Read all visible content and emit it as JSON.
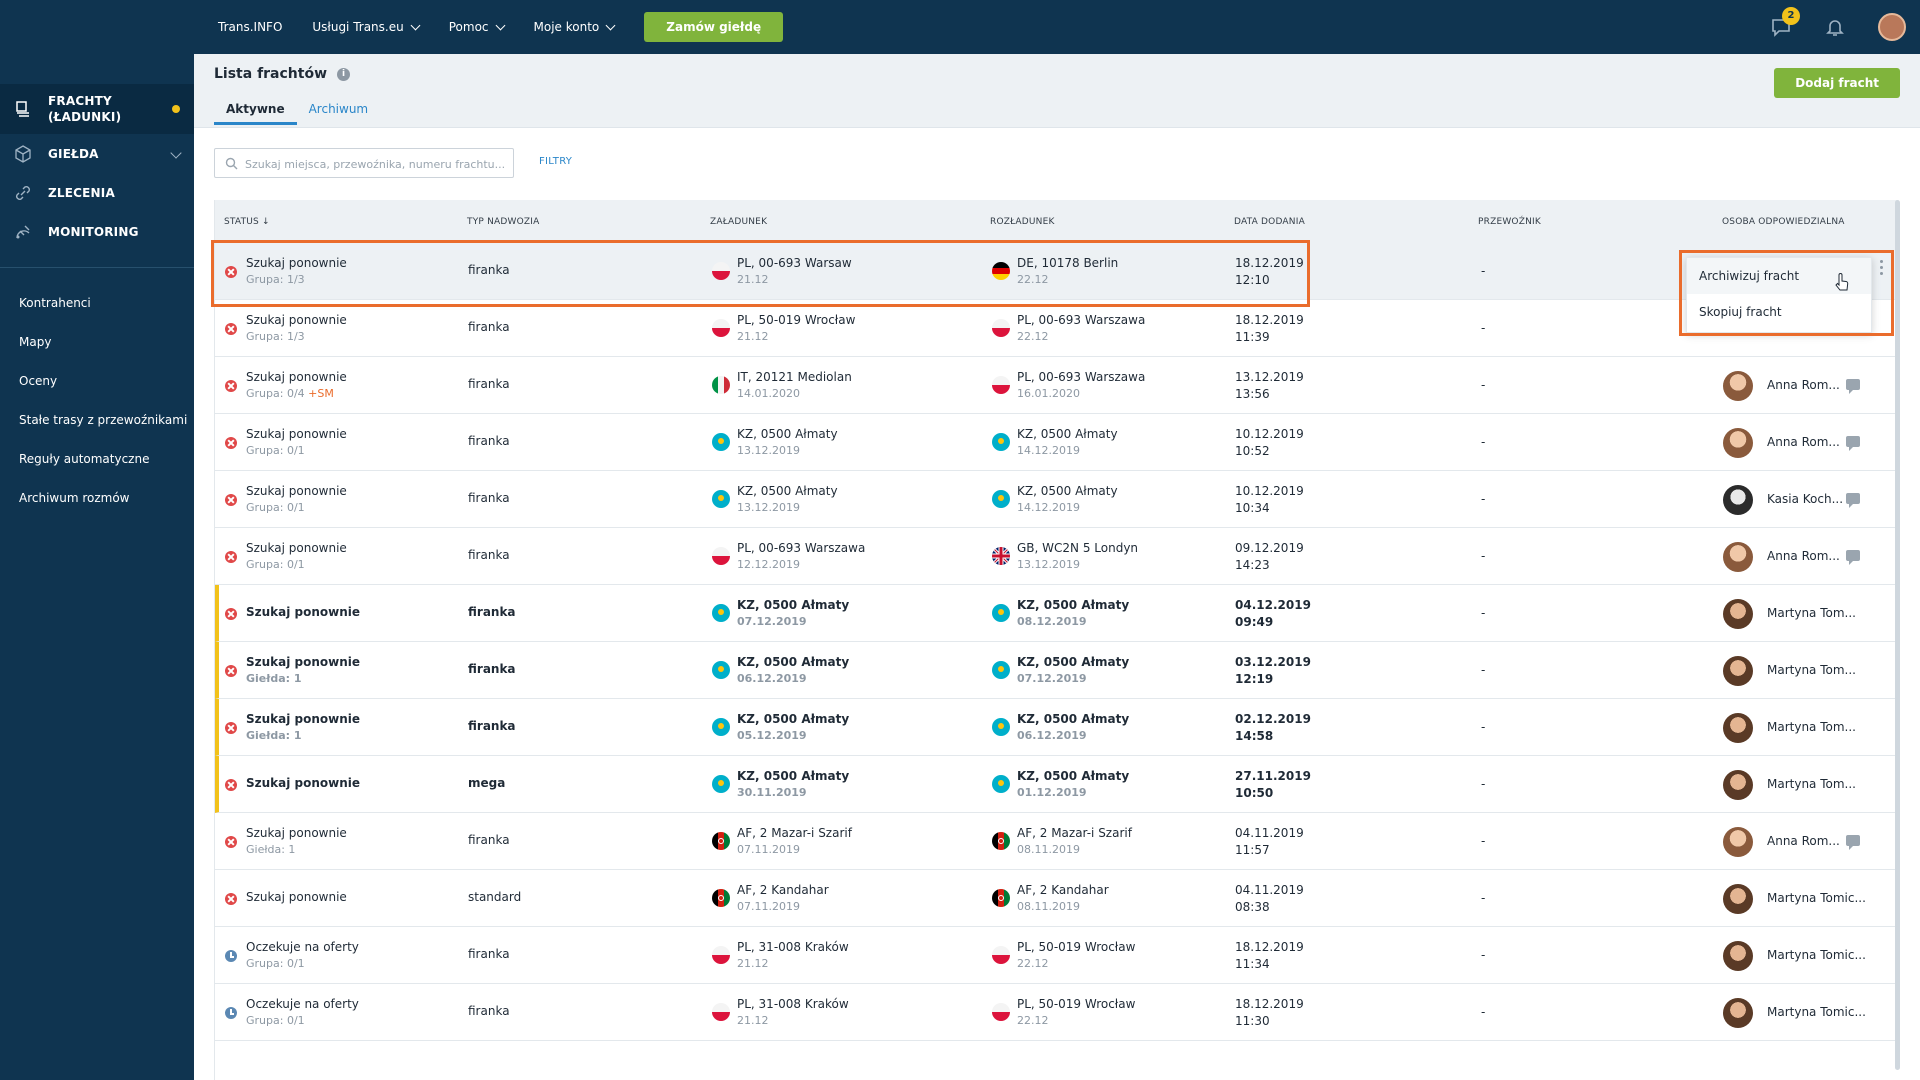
{
  "sidebar": {
    "nav": [
      {
        "label": "FRACHTY\n(ŁADUNKI)",
        "line1": "FRACHTY",
        "line2": "(ŁADUNKI)"
      },
      {
        "label": "GIEŁDA"
      },
      {
        "label": "ZLECENIA"
      },
      {
        "label": "MONITORING"
      }
    ],
    "links": [
      "Kontrahenci",
      "Mapy",
      "Oceny",
      "Stałe trasy z przewoźnikami",
      "Reguły automatyczne",
      "Archiwum rozmów"
    ]
  },
  "topbar": {
    "links": [
      "Trans.INFO",
      "Usługi Trans.eu",
      "Pomoc",
      "Moje konto"
    ],
    "cta": "Zamów giełdę",
    "notification_count": "2"
  },
  "header": {
    "title": "Lista frachtów",
    "tabs": [
      "Aktywne",
      "Archiwum"
    ],
    "add_button": "Dodaj fracht"
  },
  "search": {
    "placeholder": "Szukaj miejsca, przewoźnika, numeru frachtu...",
    "filters_label": "FILTRY"
  },
  "table": {
    "columns": [
      "STATUS ↓",
      "TYP NADWOZIA",
      "ZAŁADUNEK",
      "ROZŁADUNEK",
      "DATA DODANIA",
      "PRZEWOŹNIK",
      "OSOBA ODPOWIEDZIALNA"
    ],
    "rows": [
      {
        "status": "Szukaj ponownie",
        "sub": "Grupa: 1/3",
        "sm": "",
        "type": "firanka",
        "load": "PL, 00-693 Warsaw",
        "load_date": "21.12",
        "load_flag": "pl",
        "unload": "DE, 10178 Berlin",
        "unload_date": "22.12",
        "unload_flag": "de",
        "date": "18.12.2019",
        "time": "12:10",
        "carrier": "-",
        "person": "",
        "avatar": "",
        "icon": "x",
        "bold": false
      },
      {
        "status": "Szukaj ponownie",
        "sub": "Grupa: 1/3",
        "sm": "",
        "type": "firanka",
        "load": "PL, 50-019 Wrocław",
        "load_date": "21.12",
        "load_flag": "pl",
        "unload": "PL, 00-693 Warszawa",
        "unload_date": "22.12",
        "unload_flag": "pl",
        "date": "18.12.2019",
        "time": "11:39",
        "carrier": "-",
        "person": "",
        "avatar": "",
        "icon": "x",
        "bold": false
      },
      {
        "status": "Szukaj ponownie",
        "sub": "Grupa: 0/4",
        "sm": "+SM",
        "type": "firanka",
        "load": "IT, 20121 Mediolan",
        "load_date": "14.01.2020",
        "load_flag": "it",
        "unload": "PL, 00-693 Warszawa",
        "unload_date": "16.01.2020",
        "unload_flag": "pl",
        "date": "13.12.2019",
        "time": "13:56",
        "carrier": "-",
        "person": "Anna Rom...",
        "avatar": "anna",
        "icon": "x",
        "bold": false,
        "chat": true
      },
      {
        "status": "Szukaj ponownie",
        "sub": "Grupa: 0/1",
        "sm": "",
        "type": "firanka",
        "load": "KZ, 0500 Ałmaty",
        "load_date": "13.12.2019",
        "load_flag": "kz",
        "unload": "KZ, 0500 Ałmaty",
        "unload_date": "14.12.2019",
        "unload_flag": "kz",
        "date": "10.12.2019",
        "time": "10:52",
        "carrier": "-",
        "person": "Anna Rom...",
        "avatar": "anna",
        "icon": "x",
        "bold": false,
        "chat": true
      },
      {
        "status": "Szukaj ponownie",
        "sub": "Grupa: 0/1",
        "sm": "",
        "type": "firanka",
        "load": "KZ, 0500 Ałmaty",
        "load_date": "13.12.2019",
        "load_flag": "kz",
        "unload": "KZ, 0500 Ałmaty",
        "unload_date": "14.12.2019",
        "unload_flag": "kz",
        "date": "10.12.2019",
        "time": "10:34",
        "carrier": "-",
        "person": "Kasia Koch...",
        "avatar": "kasia",
        "icon": "x",
        "bold": false,
        "chat": true
      },
      {
        "status": "Szukaj ponownie",
        "sub": "Grupa: 0/1",
        "sm": "",
        "type": "firanka",
        "load": "PL, 00-693 Warszawa",
        "load_date": "12.12.2019",
        "load_flag": "pl",
        "unload": "GB, WC2N 5 Londyn",
        "unload_date": "13.12.2019",
        "unload_flag": "gb",
        "date": "09.12.2019",
        "time": "14:23",
        "carrier": "-",
        "person": "Anna Rom...",
        "avatar": "anna",
        "icon": "x",
        "bold": false,
        "chat": true
      },
      {
        "status": "Szukaj ponownie",
        "sub": "",
        "sm": "",
        "type": "firanka",
        "load": "KZ, 0500 Ałmaty",
        "load_date": "07.12.2019",
        "load_flag": "kz",
        "unload": "KZ, 0500 Ałmaty",
        "unload_date": "08.12.2019",
        "unload_flag": "kz",
        "date": "04.12.2019",
        "time": "09:49",
        "carrier": "-",
        "person": "Martyna Tom...",
        "avatar": "martyna",
        "icon": "x",
        "bold": true
      },
      {
        "status": "Szukaj ponownie",
        "sub": "Giełda: 1",
        "sm": "",
        "type": "firanka",
        "load": "KZ, 0500 Ałmaty",
        "load_date": "06.12.2019",
        "load_flag": "kz",
        "unload": "KZ, 0500 Ałmaty",
        "unload_date": "07.12.2019",
        "unload_flag": "kz",
        "date": "03.12.2019",
        "time": "12:19",
        "carrier": "-",
        "person": "Martyna Tom...",
        "avatar": "martyna",
        "icon": "x",
        "bold": true
      },
      {
        "status": "Szukaj ponownie",
        "sub": "Giełda: 1",
        "sm": "",
        "type": "firanka",
        "load": "KZ, 0500 Ałmaty",
        "load_date": "05.12.2019",
        "load_flag": "kz",
        "unload": "KZ, 0500 Ałmaty",
        "unload_date": "06.12.2019",
        "unload_flag": "kz",
        "date": "02.12.2019",
        "time": "14:58",
        "carrier": "-",
        "person": "Martyna Tom...",
        "avatar": "martyna",
        "icon": "x",
        "bold": true
      },
      {
        "status": "Szukaj ponownie",
        "sub": "",
        "sm": "",
        "type": "mega",
        "load": "KZ, 0500 Ałmaty",
        "load_date": "30.11.2019",
        "load_flag": "kz",
        "unload": "KZ, 0500 Ałmaty",
        "unload_date": "01.12.2019",
        "unload_flag": "kz",
        "date": "27.11.2019",
        "time": "10:50",
        "carrier": "-",
        "person": "Martyna Tom...",
        "avatar": "martyna",
        "icon": "x",
        "bold": true
      },
      {
        "status": "Szukaj ponownie",
        "sub": "Giełda: 1",
        "sm": "",
        "type": "firanka",
        "load": "AF, 2 Mazar-i Szarif",
        "load_date": "07.11.2019",
        "load_flag": "af",
        "unload": "AF, 2 Mazar-i Szarif",
        "unload_date": "08.11.2019",
        "unload_flag": "af",
        "date": "04.11.2019",
        "time": "11:57",
        "carrier": "-",
        "person": "Anna Rom...",
        "avatar": "anna",
        "icon": "x",
        "bold": false,
        "chat": true
      },
      {
        "status": "Szukaj ponownie",
        "sub": "",
        "sm": "",
        "type": "standard",
        "load": "AF, 2 Kandahar",
        "load_date": "07.11.2019",
        "load_flag": "af",
        "unload": "AF, 2 Kandahar",
        "unload_date": "08.11.2019",
        "unload_flag": "af",
        "date": "04.11.2019",
        "time": "08:38",
        "carrier": "-",
        "person": "Martyna Tomic...",
        "avatar": "martyna",
        "icon": "x",
        "bold": false
      },
      {
        "status": "Oczekuje na oferty",
        "sub": "Grupa: 0/1",
        "sm": "",
        "type": "firanka",
        "load": "PL, 31-008 Kraków",
        "load_date": "21.12",
        "load_flag": "pl",
        "unload": "PL, 50-019 Wrocław",
        "unload_date": "22.12",
        "unload_flag": "pl",
        "date": "18.12.2019",
        "time": "11:34",
        "carrier": "-",
        "person": "Martyna Tomic...",
        "avatar": "martyna",
        "icon": "clock",
        "bold": false
      },
      {
        "status": "Oczekuje na oferty",
        "sub": "Grupa: 0/1",
        "sm": "",
        "type": "firanka",
        "load": "PL, 31-008 Kraków",
        "load_date": "21.12",
        "load_flag": "pl",
        "unload": "PL, 50-019 Wrocław",
        "unload_date": "22.12",
        "unload_flag": "pl",
        "date": "18.12.2019",
        "time": "11:30",
        "carrier": "-",
        "person": "Martyna Tomic...",
        "avatar": "martyna",
        "icon": "clock",
        "bold": false
      }
    ]
  },
  "context_menu": {
    "items": [
      "Archiwizuj fracht",
      "Skopiuj fracht"
    ]
  },
  "colors": {
    "nav_bg": "#0f3450",
    "accent_green": "#80b43c",
    "highlight_orange": "#ea6c2c",
    "link_blue": "#2a86c9",
    "warning_yellow": "#f2c21b"
  }
}
